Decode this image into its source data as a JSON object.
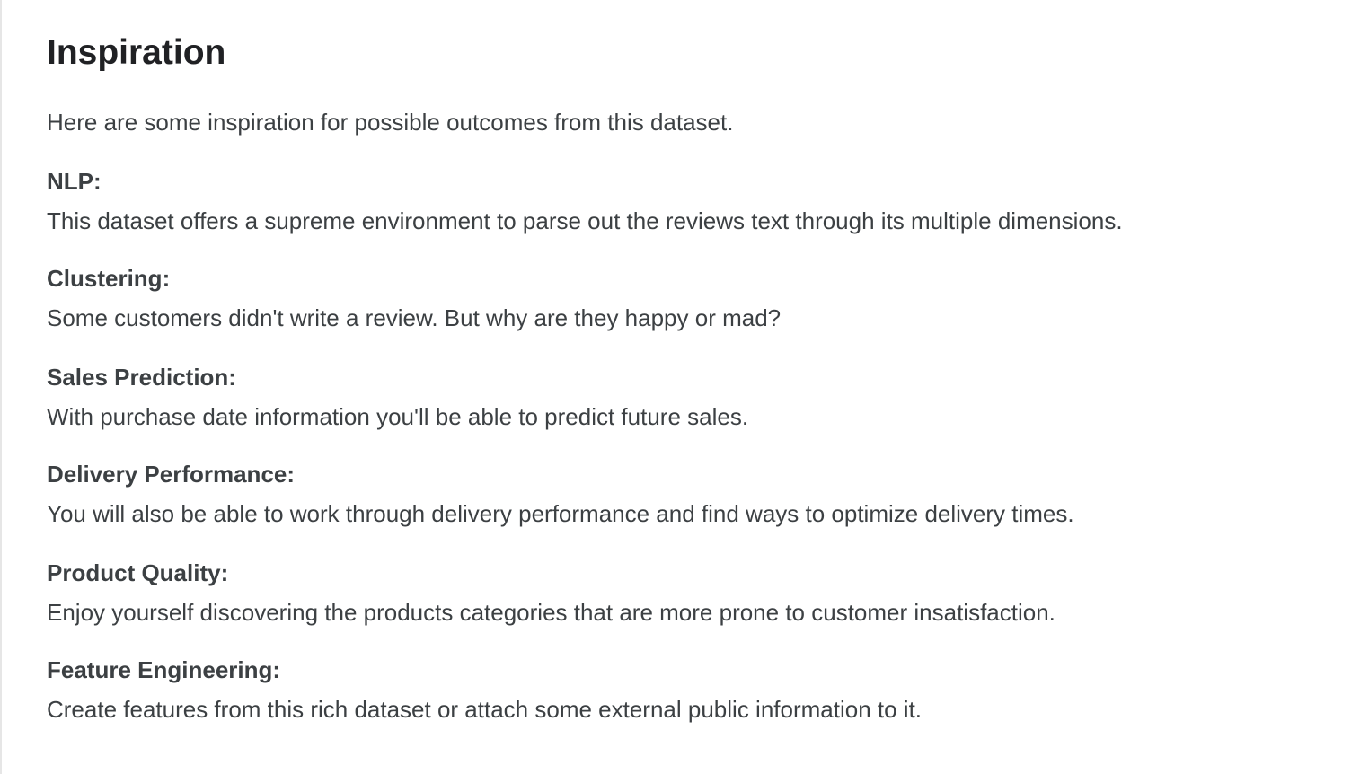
{
  "title": "Inspiration",
  "intro": "Here are some inspiration for possible outcomes from this dataset.",
  "sections": [
    {
      "heading": "NLP:",
      "text": "This dataset offers a supreme environment to parse out the reviews text through its multiple dimensions."
    },
    {
      "heading": "Clustering:",
      "text": "Some customers didn't write a review. But why are they happy or mad?"
    },
    {
      "heading": "Sales Prediction:",
      "text": "With purchase date information you'll be able to predict future sales."
    },
    {
      "heading": "Delivery Performance:",
      "text": "You will also be able to work through delivery performance and find ways to optimize delivery times."
    },
    {
      "heading": "Product Quality:",
      "text": "Enjoy yourself discovering the products categories that are more prone to customer insatisfaction."
    },
    {
      "heading": "Feature Engineering:",
      "text": "Create features from this rich dataset or attach some external public information to it."
    }
  ]
}
